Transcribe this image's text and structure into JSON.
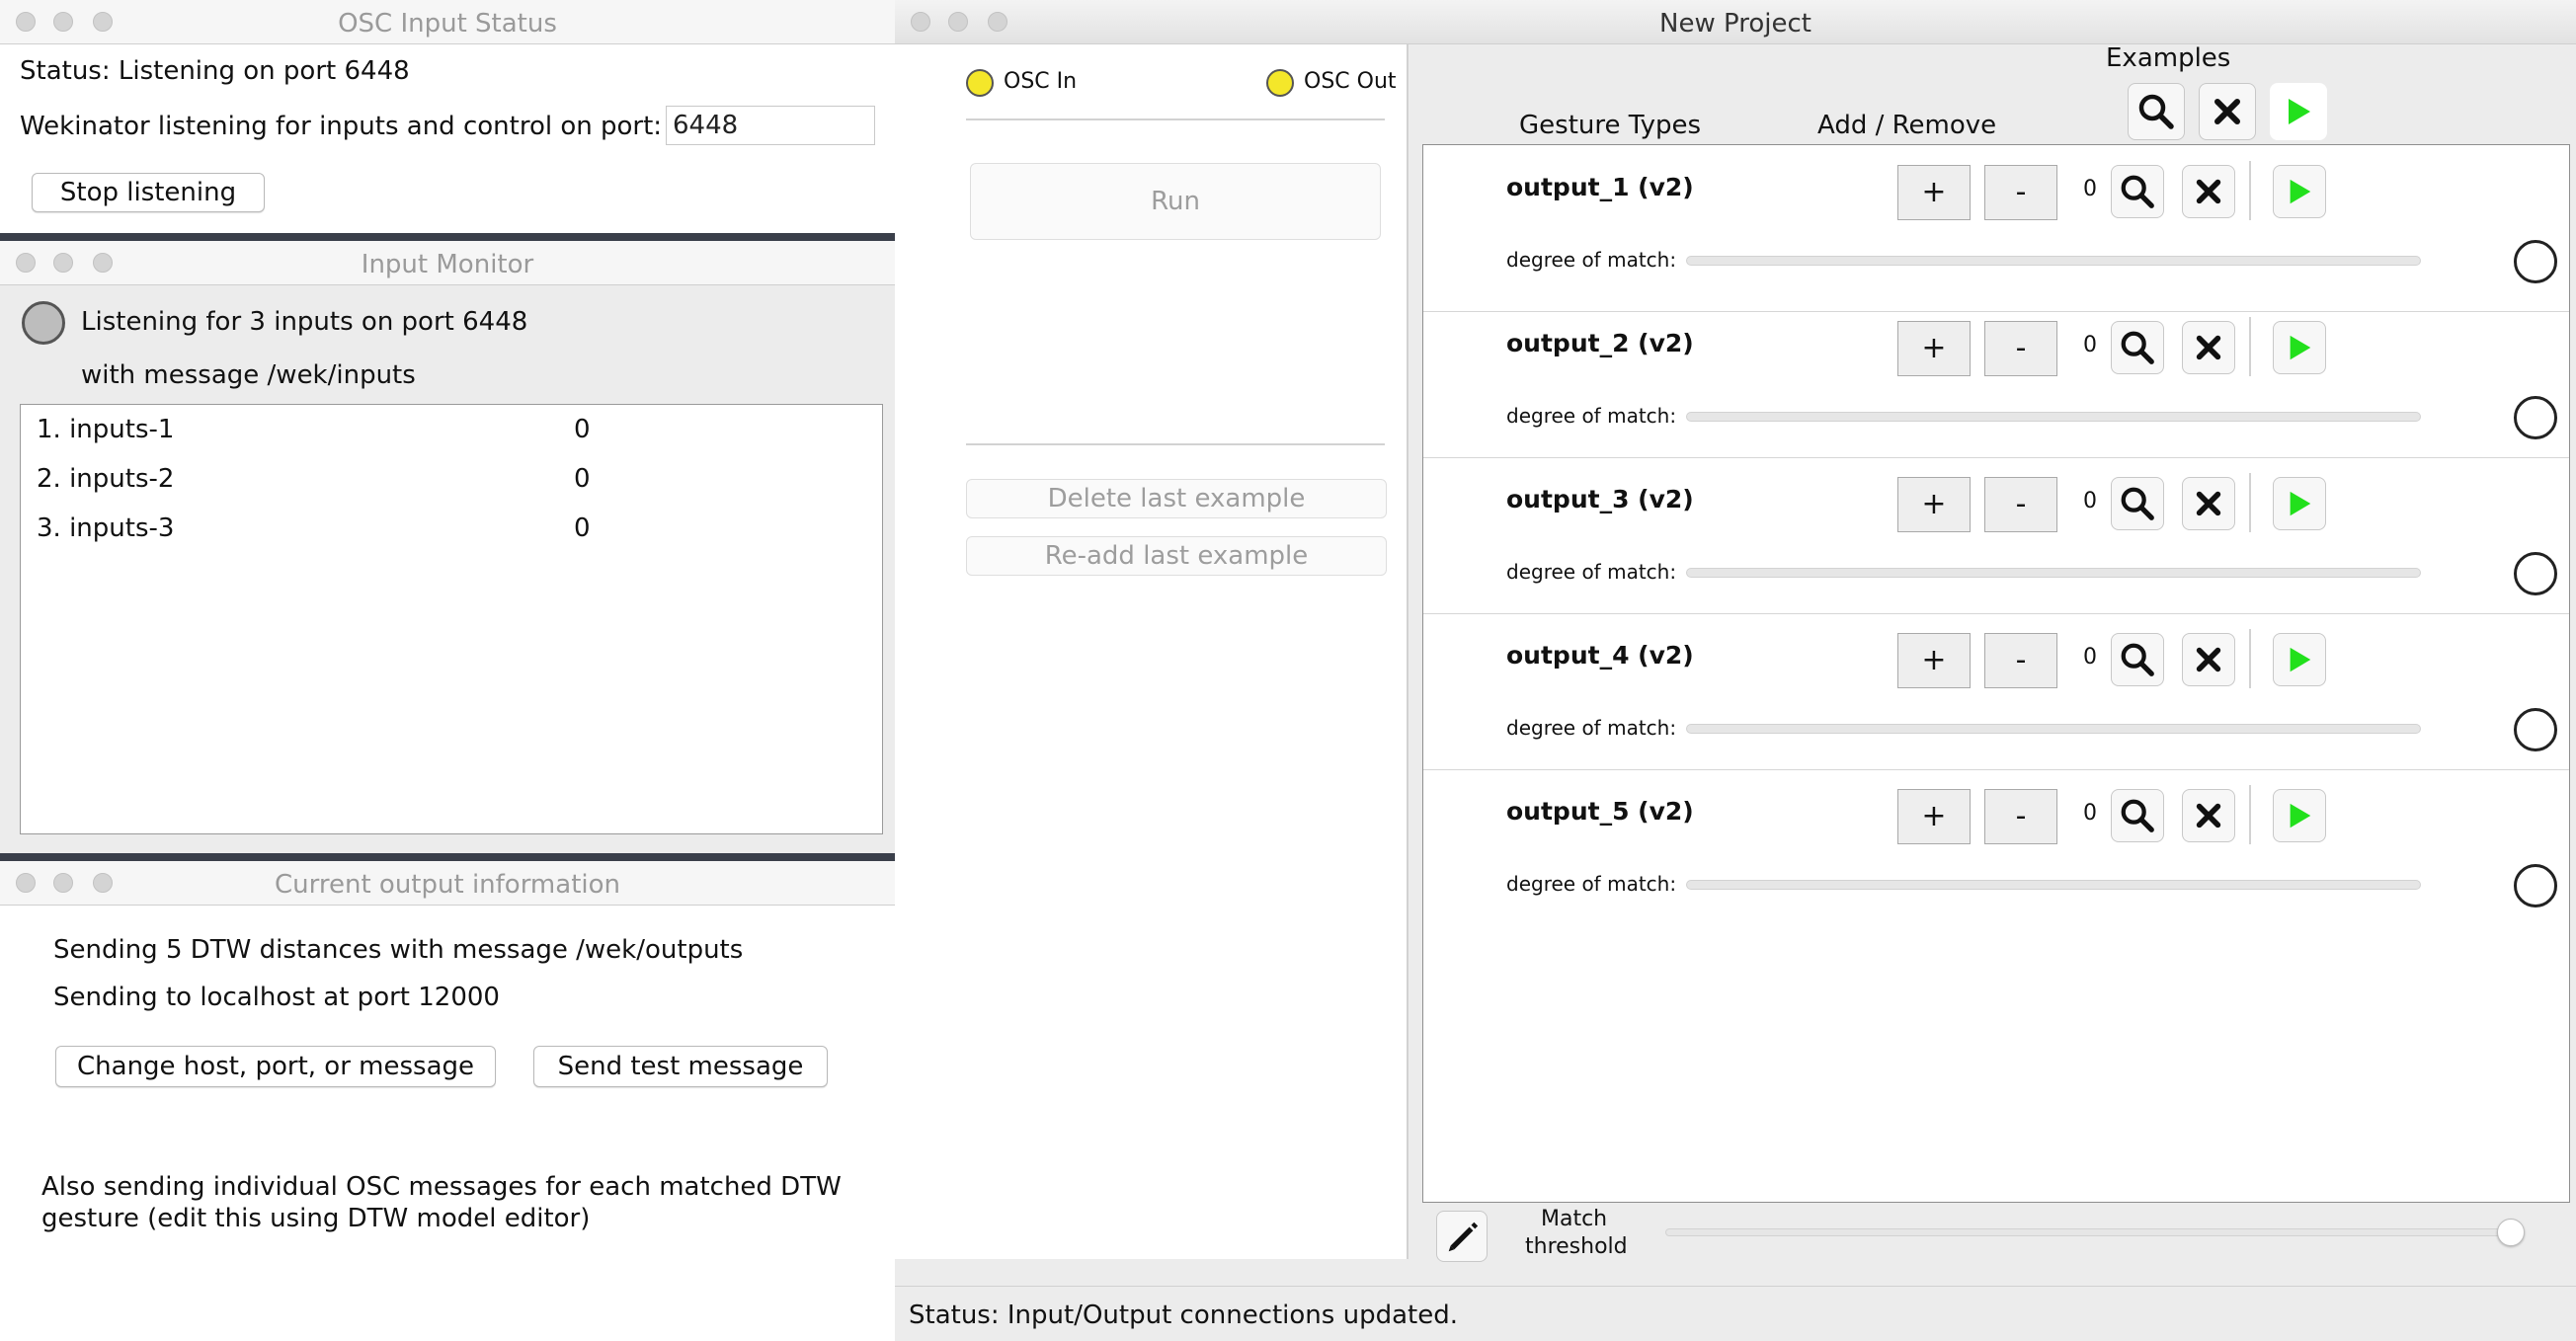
{
  "osc_input_status": {
    "title": "OSC Input Status",
    "status_line": "Status:  Listening on port 6448",
    "listening_label": "Wekinator listening for inputs and control on port:",
    "port_value": "6448",
    "stop_button": "Stop listening"
  },
  "input_monitor": {
    "title": "Input Monitor",
    "listening_line": "Listening for 3 inputs on port 6448",
    "message_line": "with message /wek/inputs",
    "inputs": [
      {
        "label": "1. inputs-1",
        "value": "0"
      },
      {
        "label": "2. inputs-2",
        "value": "0"
      },
      {
        "label": "3. inputs-3",
        "value": "0"
      }
    ]
  },
  "output_info": {
    "title": "Current output information",
    "line1": "Sending 5 DTW distances with message /wek/outputs",
    "line2": "Sending to localhost at port 12000",
    "change_button": "Change host, port, or message",
    "test_button": "Send test message",
    "note_line1": "Also sending individual OSC messages for each matched DTW",
    "note_line2": "gesture (edit this using DTW model editor)"
  },
  "project": {
    "title": "New Project",
    "osc_in": "OSC In",
    "osc_out": "OSC Out",
    "indicator_color": "#f4e72a",
    "run_button": "Run",
    "delete_button": "Delete last example",
    "readd_button": "Re-add last example",
    "examples_label": "Examples",
    "gesture_types_label": "Gesture Types",
    "add_remove_label": "Add / Remove",
    "degree_label": "degree of match:",
    "outputs": [
      {
        "name": "output_1 (v2)",
        "count": "0",
        "plus": "+",
        "minus": "-"
      },
      {
        "name": "output_2 (v2)",
        "count": "0",
        "plus": "+",
        "minus": "-"
      },
      {
        "name": "output_3 (v2)",
        "count": "0",
        "plus": "+",
        "minus": "-"
      },
      {
        "name": "output_4 (v2)",
        "count": "0",
        "plus": "+",
        "minus": "-"
      },
      {
        "name": "output_5 (v2)",
        "count": "0",
        "plus": "+",
        "minus": "-"
      }
    ],
    "match_threshold_line1": "Match",
    "match_threshold_line2": "threshold",
    "status": "Status:  Input/Output connections updated.",
    "play_color": "#22e01c"
  }
}
